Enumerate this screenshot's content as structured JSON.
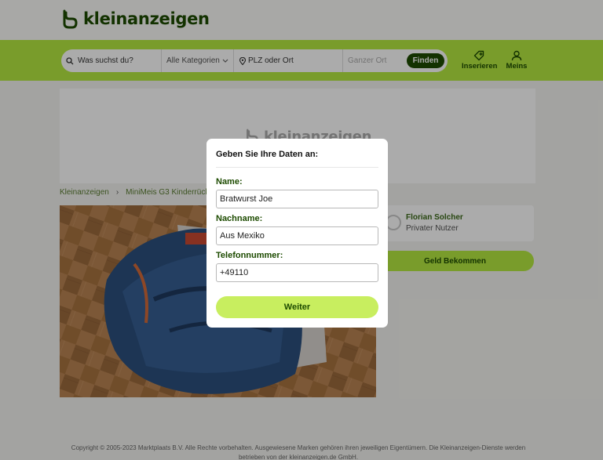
{
  "header": {
    "logo_text": "kleinanzeigen",
    "search": {
      "query_placeholder": "Was suchst du?",
      "category": "Alle Kategorien",
      "location_placeholder": "PLZ oder Ort",
      "radius": "Ganzer Ort",
      "find_label": "Finden"
    },
    "insert_label": "Inserieren",
    "account_label": "Meins"
  },
  "banner": {
    "logo_text": "kleinanzeigen"
  },
  "breadcrumb": [
    "Kleinanzeigen",
    "MiniMeis G3 Kinderrücken"
  ],
  "seller": {
    "name": "Florian Solcher",
    "status": "Privater Nutzer"
  },
  "money_button": "Geld Bekommen",
  "footer": {
    "line1": "Copyright © 2005-2023 Marktplaats B.V. Alle Rechte vorbehalten. Ausgewiesene Marken gehören ihren jeweiligen Eigentümern. Die Kleinanzeigen-Dienste werden",
    "line2": "betrieben von der kleinanzeigen.de GmbH."
  },
  "modal": {
    "title": "Geben Sie Ihre Daten an:",
    "name_label": "Name:",
    "name_value": "Bratwurst Joe",
    "lastname_label": "Nachname:",
    "lastname_value": "Aus Mexiko",
    "phone_label": "Telefonnummer:",
    "phone_value": "+49110",
    "submit_label": "Weiter"
  },
  "colors": {
    "brand_green": "#b5e941",
    "brand_dark": "#1d4b00",
    "overlay": "rgba(0,0,0,0.33)"
  }
}
